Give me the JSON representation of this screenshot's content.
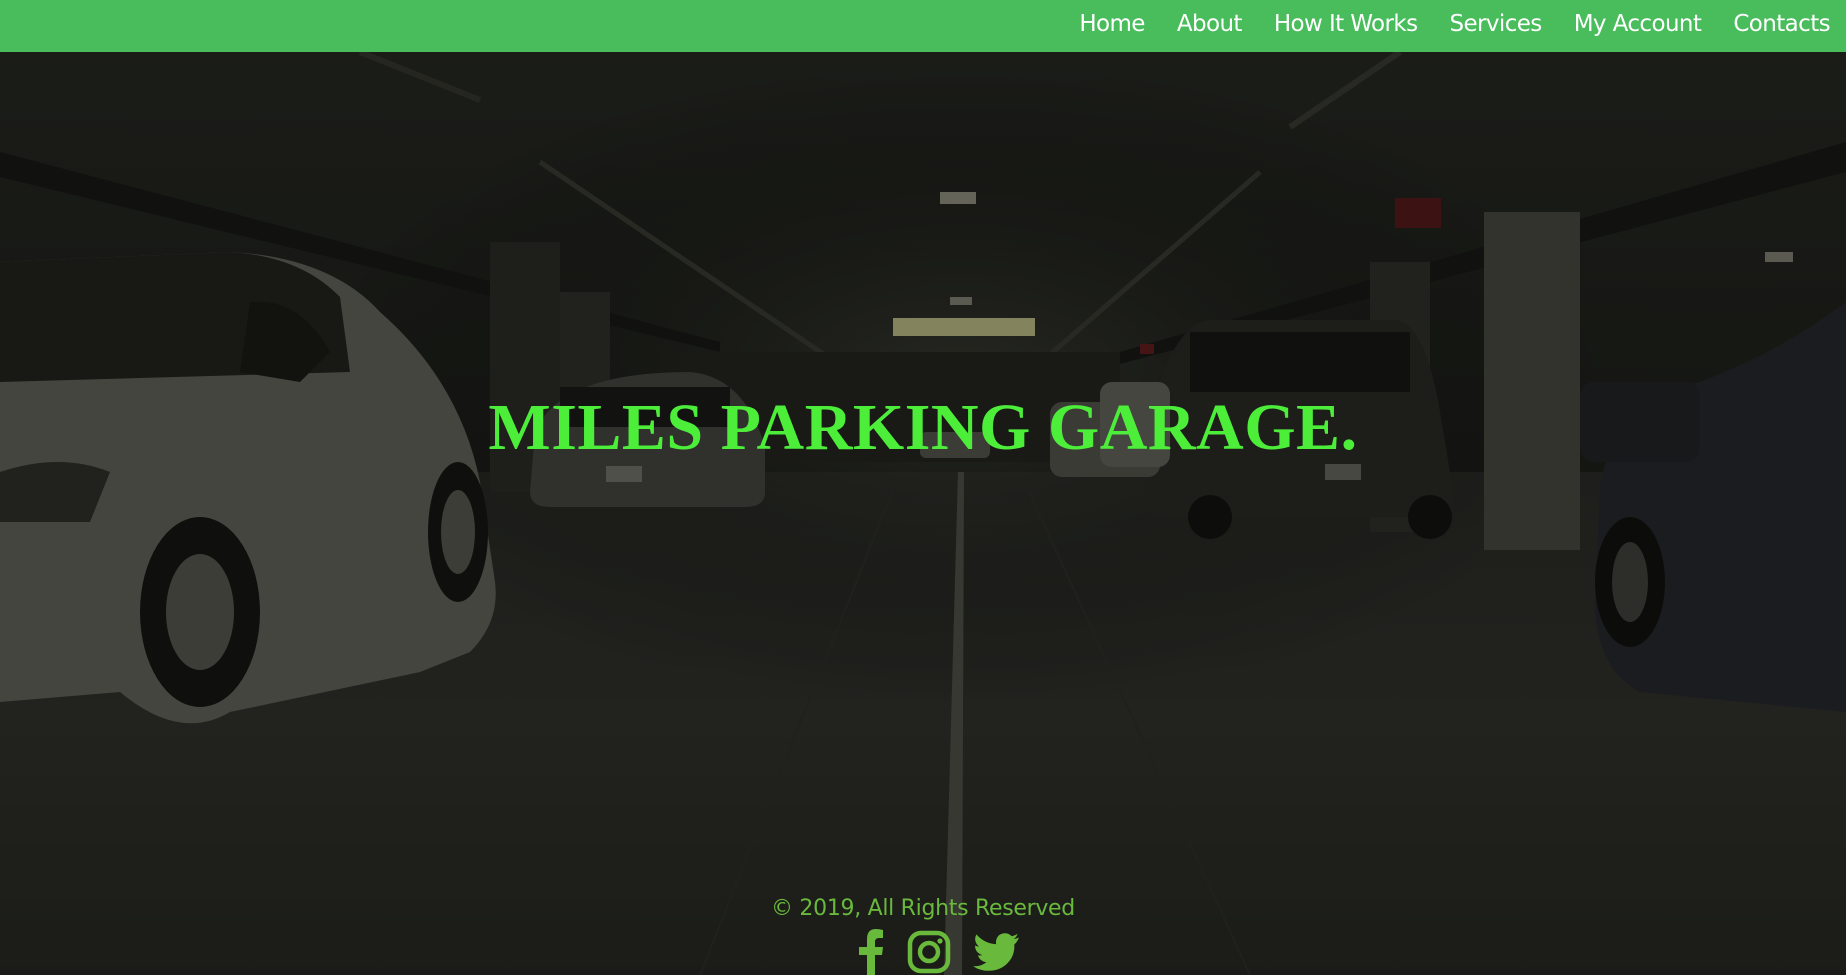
{
  "nav": {
    "items": [
      {
        "label": "Home"
      },
      {
        "label": "About"
      },
      {
        "label": "How It Works"
      },
      {
        "label": "Services"
      },
      {
        "label": "My Account"
      },
      {
        "label": "Contacts"
      }
    ]
  },
  "hero": {
    "title": "MILES PARKING GARAGE."
  },
  "footer": {
    "copyright": "© 2019, All Rights Reserved",
    "social": [
      {
        "icon": "facebook-icon"
      },
      {
        "icon": "instagram-icon"
      },
      {
        "icon": "twitter-icon"
      }
    ]
  },
  "colors": {
    "nav_background": "#49bd5c",
    "nav_text": "#ffffff",
    "title": "#4dee3a",
    "footer_text": "#69b93c"
  }
}
